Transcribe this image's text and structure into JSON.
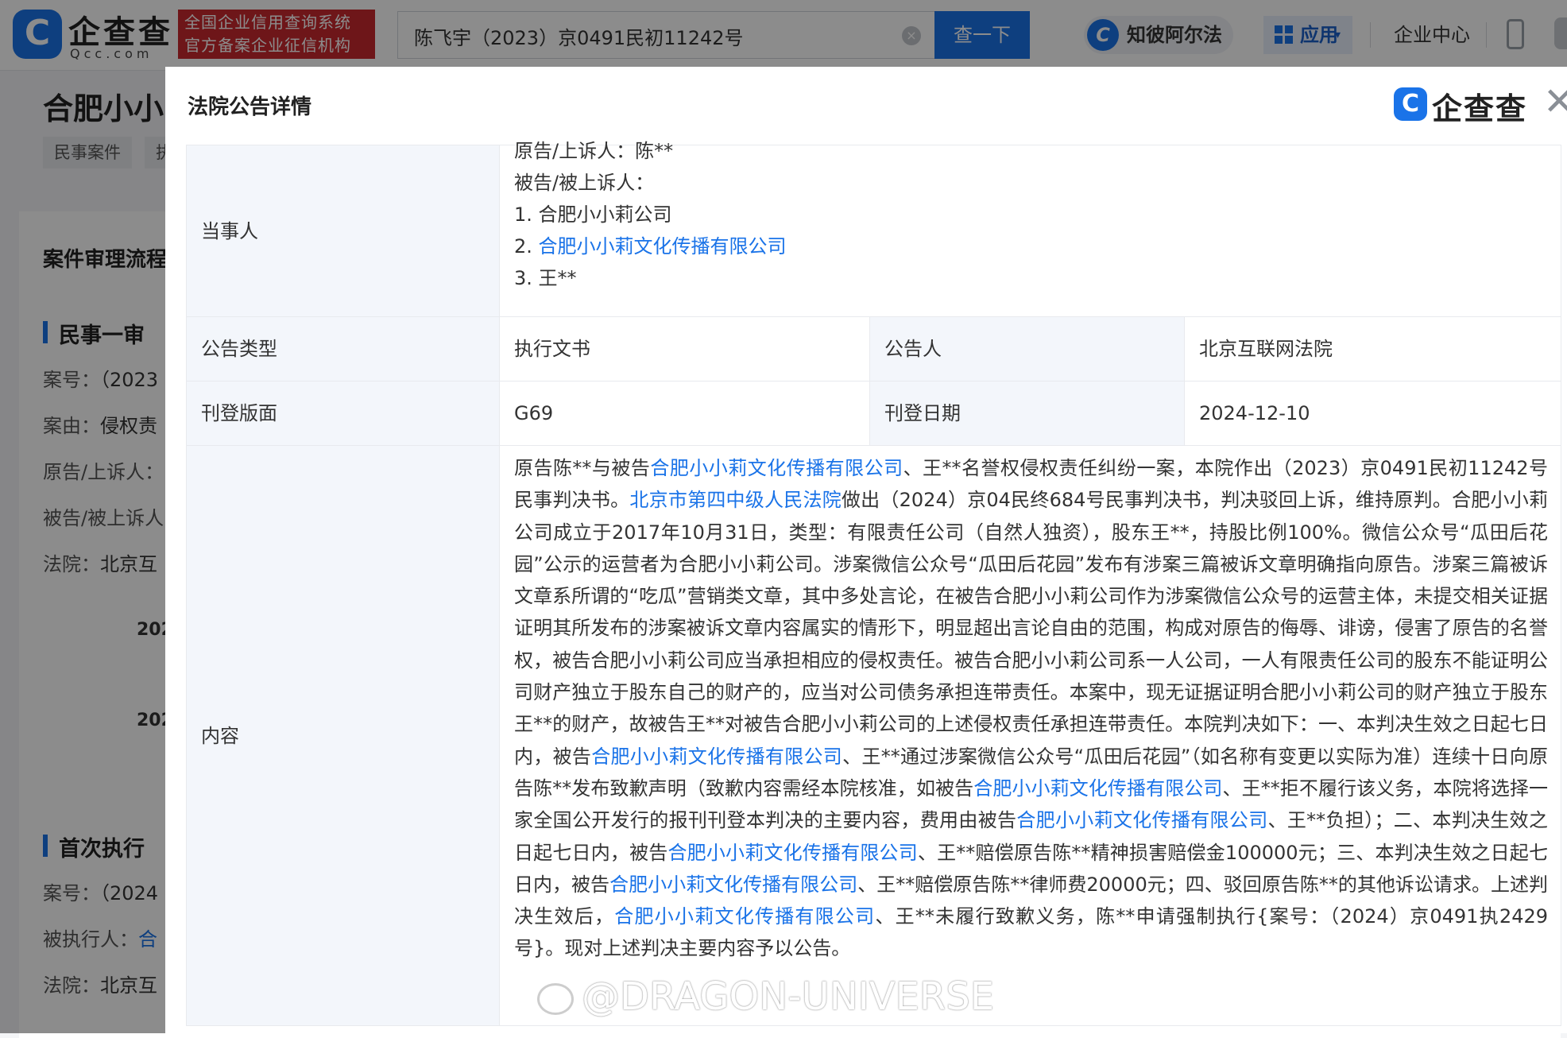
{
  "header": {
    "logo_badge": "C",
    "logo_name": "企查查",
    "logo_domain": "Qcc.com",
    "credit_line1": "全国企业信用查询系统",
    "credit_line2": "官方备案企业征信机构",
    "search_value": "陈飞宇（2023）京0491民初11242号",
    "clear_glyph": "×",
    "search_button": "查一下",
    "ai_icon": "C",
    "ai_label": "知彼阿尔法",
    "apps_label": "应用",
    "apps_caret": "▾",
    "enterprise_center": "企业中心"
  },
  "background": {
    "title": "合肥小小",
    "tags": [
      "民事案件",
      "执"
    ],
    "section_title": "案件审理流程",
    "stage1": {
      "heading": "民事一审",
      "rows": [
        {
          "label": "案号：",
          "value": "（2023"
        },
        {
          "label": "案由：",
          "value": "侵权责"
        },
        {
          "label": "原告/上诉人：",
          "value": ""
        },
        {
          "label": "被告/被上诉人",
          "value": ""
        },
        {
          "label": "法院：",
          "value": "北京互"
        }
      ],
      "years": [
        "202",
        "202"
      ]
    },
    "stage2": {
      "heading": "首次执行",
      "rows": [
        {
          "label": "案号：",
          "value": "（2024"
        },
        {
          "label": "被执行人：",
          "value": "合"
        },
        {
          "label": "法院：",
          "value": "北京互"
        }
      ]
    }
  },
  "modal": {
    "title": "法院公告详情",
    "brand_badge": "C",
    "brand_name": "企查查",
    "close_glyph": "✕",
    "parties": {
      "label": "当事人",
      "lines": [
        {
          "text": "原告/上诉人：陈**",
          "link": false
        },
        {
          "text": "被告/被上诉人：",
          "link": false
        },
        {
          "prefix": "1. ",
          "text": "合肥小小莉公司",
          "link": false
        },
        {
          "prefix": "2. ",
          "text": "合肥小小莉文化传播有限公司",
          "link": true
        },
        {
          "prefix": "3. ",
          "text": "王**",
          "link": false
        }
      ]
    },
    "type_label": "公告类型",
    "type_value": "执行文书",
    "announcer_label": "公告人",
    "announcer_value": "北京互联网法院",
    "page_label": "刊登版面",
    "page_value": "G69",
    "date_label": "刊登日期",
    "date_value": "2024-12-10",
    "content_label": "内容",
    "content": [
      {
        "t": "原告陈**与被告"
      },
      {
        "t": "合肥小小莉文化传播有限公司",
        "link": true
      },
      {
        "t": "、王**名誉权侵权责任纠纷一案，本院作出（2023）京0491民初11242号民事判决书。"
      },
      {
        "t": "北京市第四中级人民法院",
        "link": true
      },
      {
        "t": "做出（2024）京04民终684号民事判决书，判决驳回上诉，维持原判。合肥小小莉公司成立于2017年10月31日，类型：有限责任公司（自然人独资），股东王**，持股比例100%。微信公众号“瓜田后花园”公示的运营者为合肥小小莉公司。涉案微信公众号“瓜田后花园”发布有涉案三篇被诉文章明确指向原告。涉案三篇被诉文章系所谓的“吃瓜”营销类文章，其中多处言论，在被告合肥小小莉公司作为涉案微信公众号的运营主体，未提交相关证据证明其所发布的涉案被诉文章内容属实的情形下，明显超出言论自由的范围，构成对原告的侮辱、诽谤，侵害了原告的名誉权，被告合肥小小莉公司应当承担相应的侵权责任。被告合肥小小莉公司系一人公司，一人有限责任公司的股东不能证明公司财产独立于股东自己的财产的，应当对公司债务承担连带责任。本案中，现无证据证明合肥小小莉公司的财产独立于股东王**的财产，故被告王**对被告合肥小小莉公司的上述侵权责任承担连带责任。本院判决如下：一、本判决生效之日起七日内，被告"
      },
      {
        "t": "合肥小小莉文化传播有限公司",
        "link": true
      },
      {
        "t": "、王**通过涉案微信公众号“瓜田后花园”（如名称有变更以实际为准）连续十日向原告陈**发布致歉声明（致歉内容需经本院核准，如被告"
      },
      {
        "t": "合肥小小莉文化传播有限公司",
        "link": true
      },
      {
        "t": "、王**拒不履行该义务，本院将选择一家全国公开发行的报刊刊登本判决的主要内容，费用由被告"
      },
      {
        "t": "合肥小小莉文化传播有限公司",
        "link": true
      },
      {
        "t": "、王**负担）；二、本判决生效之日起七日内，被告"
      },
      {
        "t": "合肥小小莉文化传播有限公司",
        "link": true
      },
      {
        "t": "、王**赔偿原告陈**精神损害赔偿金100000元；三、本判决生效之日起七日内，被告"
      },
      {
        "t": "合肥小小莉文化传播有限公司",
        "link": true
      },
      {
        "t": "、王**赔偿原告陈**律师费20000元；四、驳回原告陈**的其他诉讼请求。上述判决生效后，"
      },
      {
        "t": "合肥小小莉文化传播有限公司",
        "link": true
      },
      {
        "t": "、王**未履行致歉义务，陈**申请强制执行{案号：（2024）京0491执2429号}。现对上述判决主要内容予以公告。"
      }
    ]
  },
  "watermark": "@DRAGON-UNIVERSE",
  "colors": {
    "accent": "#1a73e8",
    "credit_red": "#c8282e",
    "label_bg": "#f3f6fb"
  }
}
